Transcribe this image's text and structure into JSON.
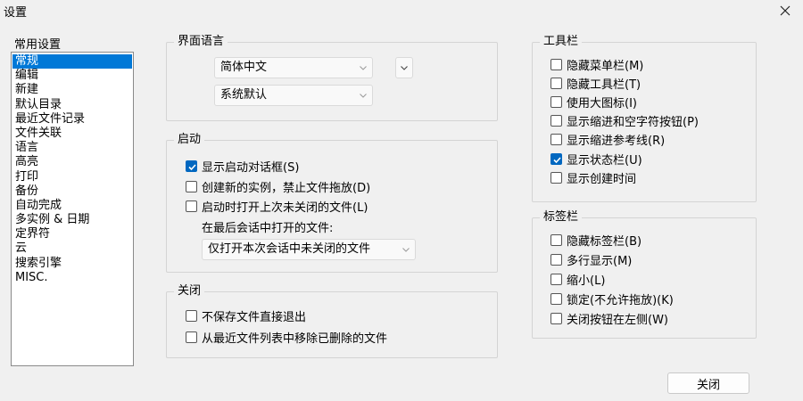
{
  "window": {
    "title": "设置"
  },
  "sidebar": {
    "heading": "常用设置",
    "items": [
      "常规",
      "编辑",
      "新建",
      "默认目录",
      "最近文件记录",
      "文件关联",
      "语言",
      "高亮",
      "打印",
      "备份",
      "自动完成",
      "多实例 & 日期",
      "定界符",
      "云",
      "搜索引擎",
      "MISC."
    ],
    "selected": "常规"
  },
  "language": {
    "legend": "界面语言",
    "language_value": "简体中文",
    "locale_value": "系统默认"
  },
  "startup": {
    "legend": "启动",
    "show_startup_dialog": "显示启动对话框(S)",
    "new_instance": "创建新的实例，禁止文件拖放(D)",
    "reopen_unclosed": "启动时打开上次未关闭的文件(L)",
    "last_session_label": "在最后会话中打开的文件:",
    "last_session_value": "仅打开本次会话中未关闭的文件"
  },
  "close": {
    "legend": "关闭",
    "exit_without_save": "不保存文件直接退出",
    "remove_deleted": "从最近文件列表中移除已删除的文件"
  },
  "toolbar": {
    "legend": "工具栏",
    "items": [
      "隐藏菜单栏(M)",
      "隐藏工具栏(T)",
      "使用大图标(I)",
      "显示缩进和空字符按钮(P)",
      "显示缩进参考线(R)",
      "显示状态栏(U)",
      "显示创建时间"
    ]
  },
  "tabs": {
    "legend": "标签栏",
    "items": [
      "隐藏标签栏(B)",
      "多行显示(M)",
      "缩小(L)",
      "锁定(不允许拖放)(K)",
      "关闭按钮在左侧(W)"
    ]
  },
  "footer": {
    "close_label": "关闭"
  },
  "colors": {
    "accent": "#0067c0",
    "selection": "#0078d7"
  }
}
